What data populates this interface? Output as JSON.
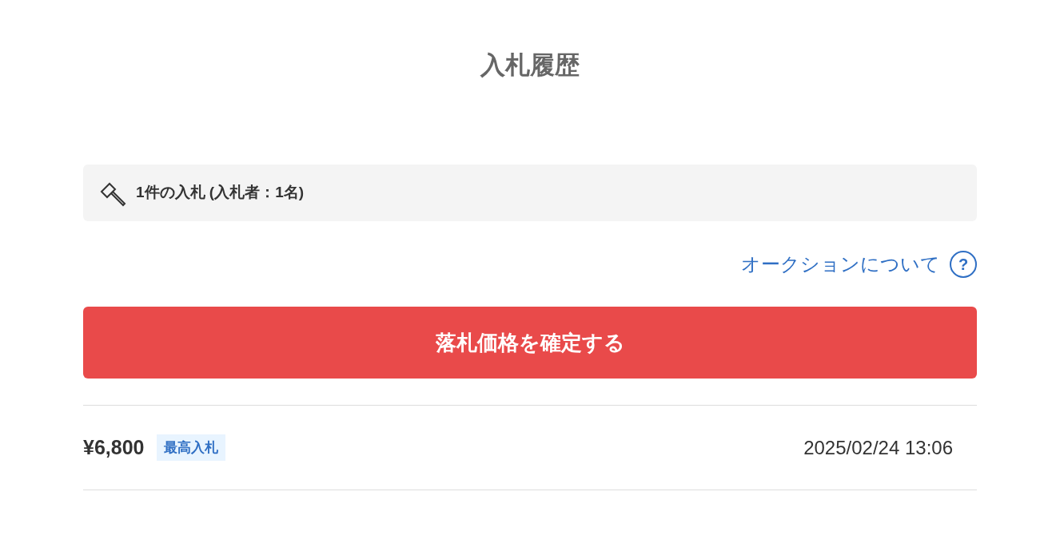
{
  "title": "入札履歴",
  "summary": {
    "text": "1件の入札 (入札者：1名)"
  },
  "help_link": {
    "label": "オークションについて",
    "icon": "?"
  },
  "confirm_button": {
    "label": "落札価格を確定する"
  },
  "bids": [
    {
      "price": "¥6,800",
      "badge": "最高入札",
      "time": "2025/02/24 13:06"
    }
  ]
}
